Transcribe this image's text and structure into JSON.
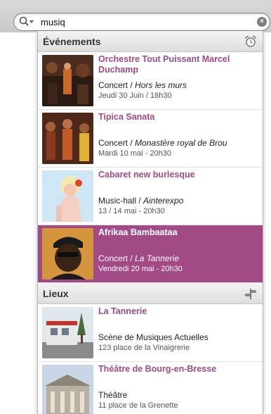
{
  "search": {
    "value": "musiq",
    "placeholder": ""
  },
  "events": {
    "title": "Événements",
    "icon": "alarm-clock-icon",
    "items": [
      {
        "title": "Orchestre Tout Puissant Marcel Duchamp",
        "type": "Concert",
        "sep": " / ",
        "venue": "Hors les murs",
        "date": "Jeudi 30 Juin / 18h30",
        "selected": false
      },
      {
        "title": "Tipica Sanata",
        "type": "Concert",
        "sep": " / ",
        "venue": "Monastère royal de Brou",
        "date": "Mardi 10 mai - 20h30",
        "selected": false
      },
      {
        "title": "Cabaret new burlesque",
        "type": "Music-hall",
        "sep": " / ",
        "venue": "Ainterexpo",
        "date": "13 / 14 mai - 20h30",
        "selected": false
      },
      {
        "title": "Afrikaa Bambaataa",
        "type": "Concert",
        "sep": " / ",
        "venue": "La Tannerie",
        "date": "Vendredi 20 mai - 20h30",
        "selected": true
      }
    ]
  },
  "places": {
    "title": "Lieux",
    "icon": "signpost-icon",
    "items": [
      {
        "title": "La Tannerie",
        "type": "Scène de Musiques Actuelles",
        "address": "123 place de la Vinaigrerie"
      },
      {
        "title": "Théâtre de Bourg-en-Bresse",
        "type": "Théâtre",
        "address": "11 place de la Grenette"
      }
    ]
  },
  "colors": {
    "accent": "#a24a86",
    "header_bg": "#e6e6e6"
  }
}
